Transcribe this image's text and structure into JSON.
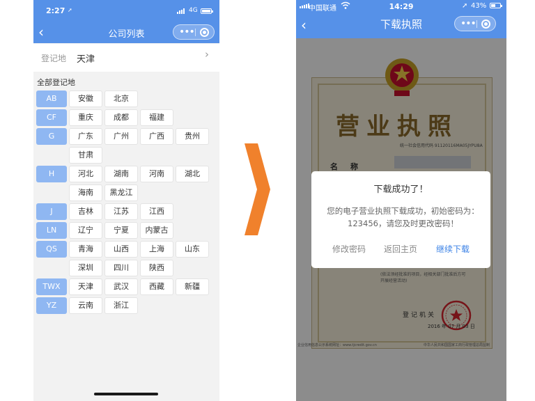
{
  "left_phone": {
    "status": {
      "time": "2:27",
      "network": "4G"
    },
    "nav": {
      "title": "公司列表"
    },
    "region": {
      "label": "登记地",
      "value": "天津"
    },
    "all_label": "全部登记地",
    "groups": [
      {
        "tag": "AB",
        "cities": [
          "安徽",
          "北京"
        ]
      },
      {
        "tag": "CF",
        "cities": [
          "重庆",
          "成都",
          "福建"
        ]
      },
      {
        "tag": "G",
        "cities": [
          "广东",
          "广州",
          "广西",
          "贵州"
        ]
      },
      {
        "tag": "",
        "cities": [
          "甘肃"
        ]
      },
      {
        "tag": "H",
        "cities": [
          "河北",
          "湖南",
          "河南",
          "湖北"
        ]
      },
      {
        "tag": "",
        "cities": [
          "海南",
          "黑龙江"
        ]
      },
      {
        "tag": "J",
        "cities": [
          "吉林",
          "江苏",
          "江西"
        ]
      },
      {
        "tag": "LN",
        "cities": [
          "辽宁",
          "宁夏",
          "内蒙古"
        ]
      },
      {
        "tag": "QS",
        "cities": [
          "青海",
          "山西",
          "上海",
          "山东"
        ]
      },
      {
        "tag": "",
        "cities": [
          "深圳",
          "四川",
          "陕西"
        ]
      },
      {
        "tag": "TWX",
        "cities": [
          "天津",
          "武汉",
          "西藏",
          "新疆"
        ]
      },
      {
        "tag": "YZ",
        "cities": [
          "云南",
          "浙江"
        ]
      }
    ]
  },
  "right_phone": {
    "status": {
      "carrier": "中国联通",
      "time": "14:29",
      "battery": "43%"
    },
    "nav": {
      "title": "下载执照"
    },
    "license": {
      "title": "营业执照",
      "code_label": "统一社会信用代码 91120116MA05JYPU8A",
      "name_label": "名称",
      "scope_text": "(依法须经批准的项目，经相关部门批准后方可\n开展经营活动)",
      "authority": "登记机关",
      "date": "2016 年 07 月 03 日",
      "footer_left": "企业信用信息公示系统网址：www.tjcredit.gov.cn",
      "footer_right": "中华人民共和国国家工商行政管理总局监制"
    },
    "dialog": {
      "title": "下载成功了！",
      "message": "您的电子营业执照下载成功，初始密码为：123456，请您及时更改密码！",
      "buttons": [
        "修改密码",
        "返回主页",
        "继续下载"
      ]
    }
  },
  "colors": {
    "accent": "#5691e8",
    "tag": "#8fb7f2",
    "arrow": "#f0812c",
    "link": "#3b82e6"
  }
}
